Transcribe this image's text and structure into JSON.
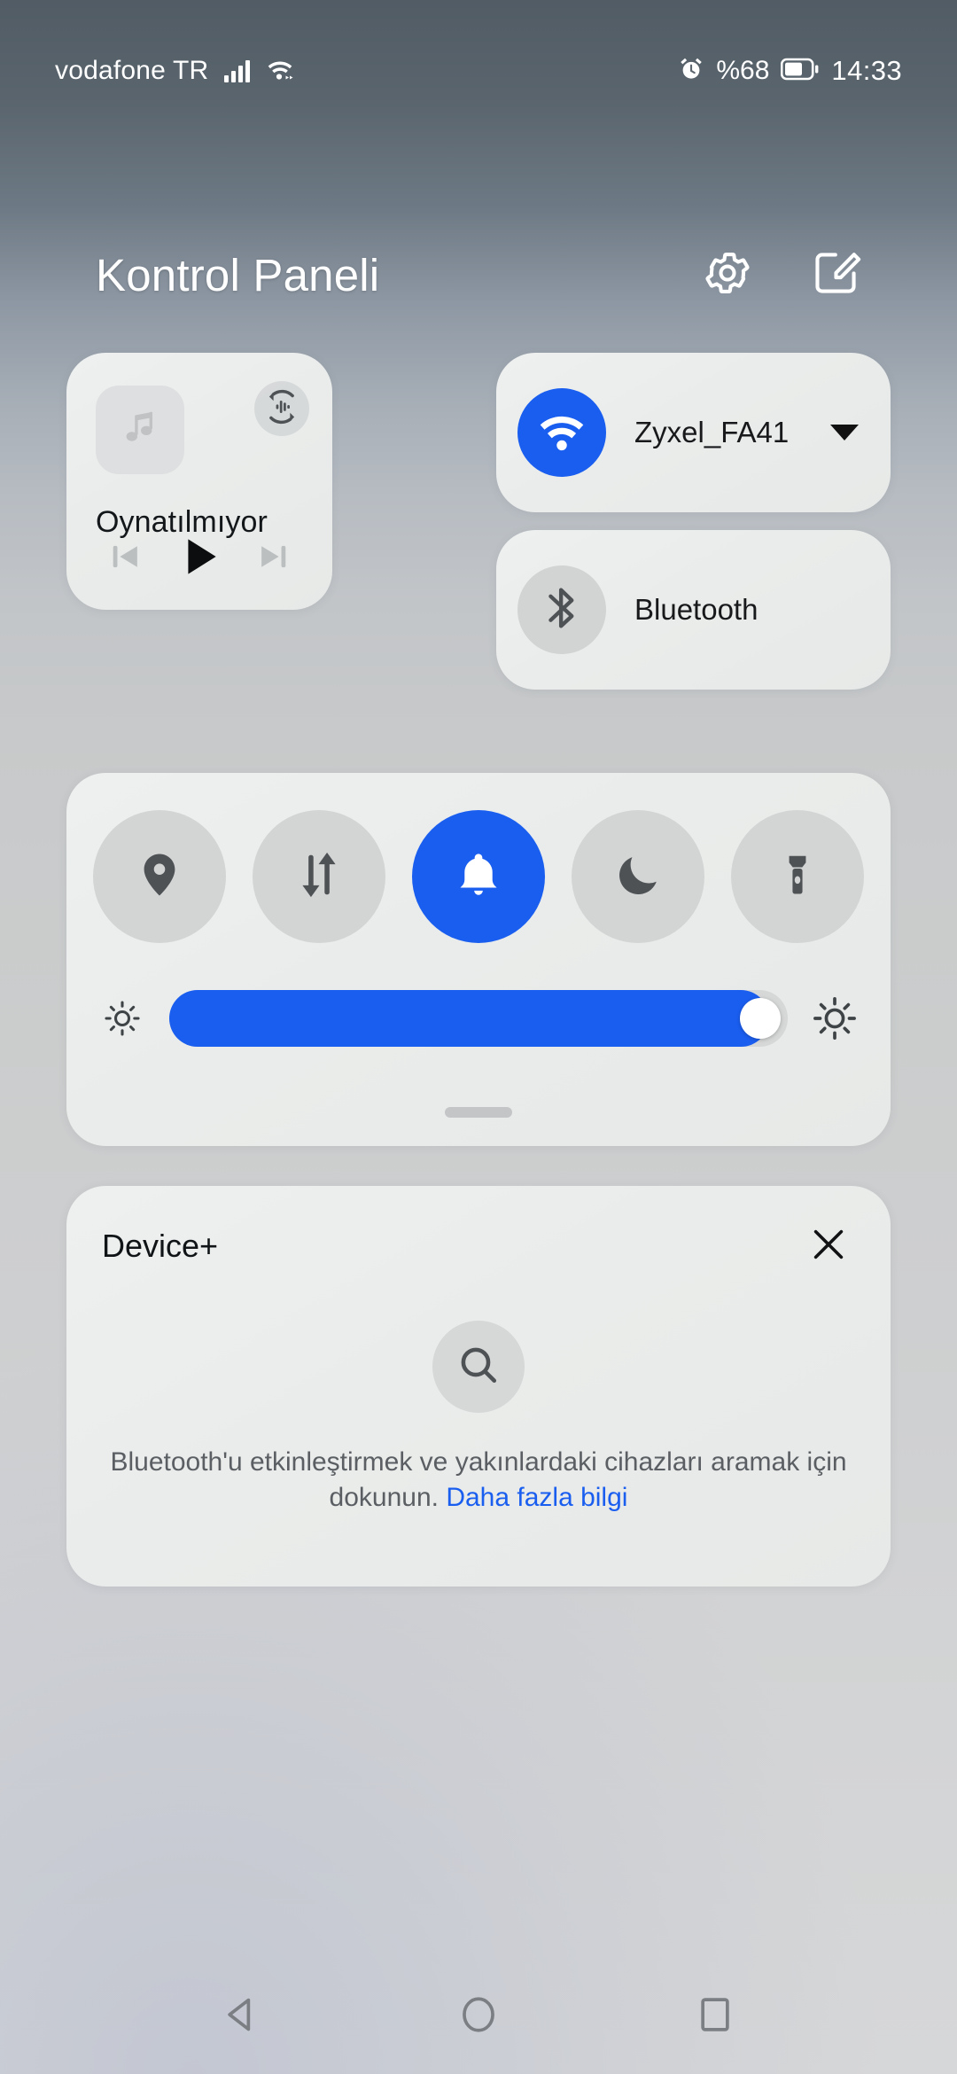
{
  "status_bar": {
    "carrier": "vodafone TR",
    "signal_icon": "signal-bars-icon",
    "wifi_icon": "wifi-icon",
    "alarm_icon": "alarm-icon",
    "battery_percent": "%68",
    "battery_icon": "battery-icon",
    "time": "14:33"
  },
  "header": {
    "title": "Kontrol Paneli",
    "settings_icon": "gear-icon",
    "edit_icon": "edit-square-icon"
  },
  "media": {
    "album_icon": "music-note-icon",
    "cast_icon": "audio-output-switch-icon",
    "title": "Oynatılmıyor",
    "prev_icon": "skip-previous-icon",
    "play_icon": "play-icon",
    "next_icon": "skip-next-icon"
  },
  "connectivity": [
    {
      "name": "wifi",
      "label": "Zyxel_FA41",
      "icon": "wifi-icon",
      "state": "on",
      "accent": "#1a5ef0",
      "has_caret": true
    },
    {
      "name": "bluetooth",
      "label": "Bluetooth",
      "icon": "bluetooth-icon",
      "state": "off",
      "accent": "#d2d3d3",
      "has_caret": false
    }
  ],
  "toggles": [
    {
      "name": "location",
      "icon": "location-pin-icon",
      "state": "off"
    },
    {
      "name": "mobile-data",
      "icon": "data-transfer-icon",
      "state": "off"
    },
    {
      "name": "ring-mode",
      "icon": "bell-icon",
      "state": "on"
    },
    {
      "name": "dark-mode",
      "icon": "moon-icon",
      "state": "off"
    },
    {
      "name": "flashlight",
      "icon": "flashlight-icon",
      "state": "off"
    }
  ],
  "brightness": {
    "low_icon": "brightness-low-icon",
    "high_icon": "brightness-high-icon",
    "value_percent": 97
  },
  "device_plus": {
    "title": "Device+",
    "close_icon": "close-icon",
    "search_icon": "search-icon",
    "description": "Bluetooth'u etkinleştirmek ve yakınlardaki cihazları aramak için dokunun.",
    "link_label": "Daha fazla bilgi"
  },
  "nav_bar": {
    "back_icon": "back-triangle-icon",
    "home_icon": "home-circle-icon",
    "recents_icon": "recents-square-icon"
  },
  "colors": {
    "accent_blue": "#1a5ef0",
    "card_bg": "#eceeed",
    "icon_gray": "#4e5255"
  }
}
